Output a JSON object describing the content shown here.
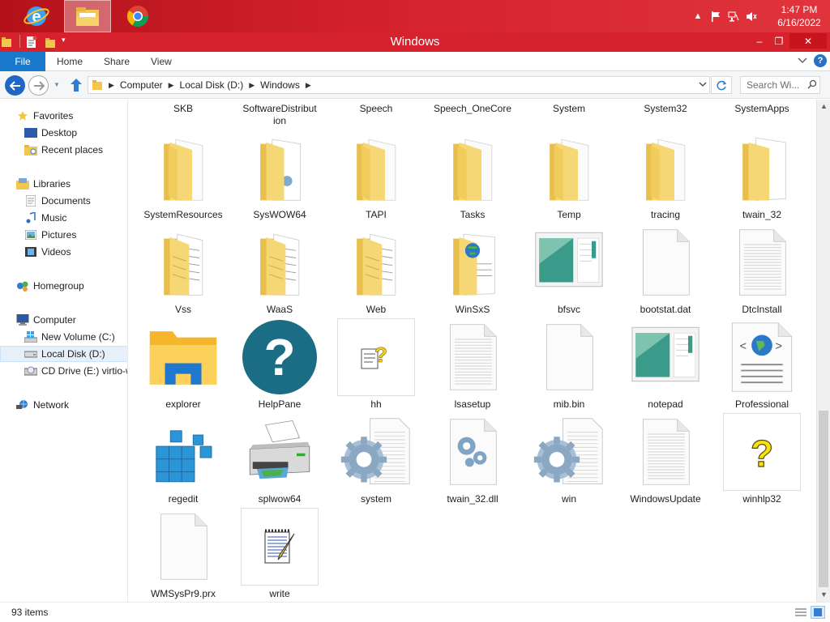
{
  "taskbar": {
    "apps": [
      {
        "name": "Internet Explorer",
        "icon": "ie-icon"
      },
      {
        "name": "File Explorer",
        "icon": "file-explorer-icon",
        "active": true
      },
      {
        "name": "Google Chrome",
        "icon": "chrome-icon"
      }
    ],
    "clock": {
      "time": "1:47 PM",
      "date": "6/16/2022"
    }
  },
  "window": {
    "title": "Windows",
    "controls": {
      "minimize": "–",
      "maximize": "❐",
      "close": "✕"
    }
  },
  "ribbon": {
    "tabs": [
      "File",
      "Home",
      "Share",
      "View"
    ]
  },
  "address": {
    "crumbs": [
      "Computer",
      "Local Disk (D:)",
      "Windows"
    ],
    "search_placeholder": "Search Wi..."
  },
  "nav_pane": {
    "favorites": {
      "label": "Favorites",
      "items": [
        "Desktop",
        "Recent places"
      ]
    },
    "libraries": {
      "label": "Libraries",
      "items": [
        "Documents",
        "Music",
        "Pictures",
        "Videos"
      ]
    },
    "homegroup": {
      "label": "Homegroup"
    },
    "computer": {
      "label": "Computer",
      "items": [
        "New Volume (C:)",
        "Local Disk (D:)",
        "CD Drive (E:) virtio-w"
      ]
    },
    "network": {
      "label": "Network"
    },
    "selected": "Local Disk (D:)"
  },
  "content": {
    "top_partial_row": [
      "SKB",
      "SoftwareDistribution",
      "Speech",
      "Speech_OneCore",
      "System",
      "System32",
      "SystemApps"
    ],
    "items": [
      {
        "label": "SystemResources",
        "type": "folder"
      },
      {
        "label": "SysWOW64",
        "type": "folder-gear"
      },
      {
        "label": "TAPI",
        "type": "folder"
      },
      {
        "label": "Tasks",
        "type": "folder"
      },
      {
        "label": "Temp",
        "type": "folder"
      },
      {
        "label": "tracing",
        "type": "folder"
      },
      {
        "label": "twain_32",
        "type": "folder-doc"
      },
      {
        "label": "Vss",
        "type": "folder-docs"
      },
      {
        "label": "WaaS",
        "type": "folder-docs"
      },
      {
        "label": "Web",
        "type": "folder-docs"
      },
      {
        "label": "WinSxS",
        "type": "folder-web"
      },
      {
        "label": "bfsvc",
        "type": "app-window"
      },
      {
        "label": "bootstat.dat",
        "type": "file-blank"
      },
      {
        "label": "DtcInstall",
        "type": "file-text"
      },
      {
        "label": "explorer",
        "type": "explorer"
      },
      {
        "label": "HelpPane",
        "type": "help"
      },
      {
        "label": "hh",
        "type": "hh"
      },
      {
        "label": "lsasetup",
        "type": "file-text"
      },
      {
        "label": "mib.bin",
        "type": "file-blank"
      },
      {
        "label": "notepad",
        "type": "app-window"
      },
      {
        "label": "Professional",
        "type": "web-doc"
      },
      {
        "label": "regedit",
        "type": "regedit"
      },
      {
        "label": "splwow64",
        "type": "printer"
      },
      {
        "label": "system",
        "type": "gear-file"
      },
      {
        "label": "twain_32.dll",
        "type": "dll"
      },
      {
        "label": "win",
        "type": "gear-file"
      },
      {
        "label": "WindowsUpdate",
        "type": "file-text"
      },
      {
        "label": "winhlp32",
        "type": "winhlp"
      },
      {
        "label": "WMSysPr9.prx",
        "type": "file-blank"
      },
      {
        "label": "write",
        "type": "write"
      }
    ]
  },
  "status": {
    "item_count": "93 items"
  },
  "colors": {
    "taskbar": "#d4222c",
    "titlebar": "#d6222c",
    "file_tab": "#1979ca",
    "folder": "#f3d36b",
    "selected": "#e5f0fb"
  }
}
